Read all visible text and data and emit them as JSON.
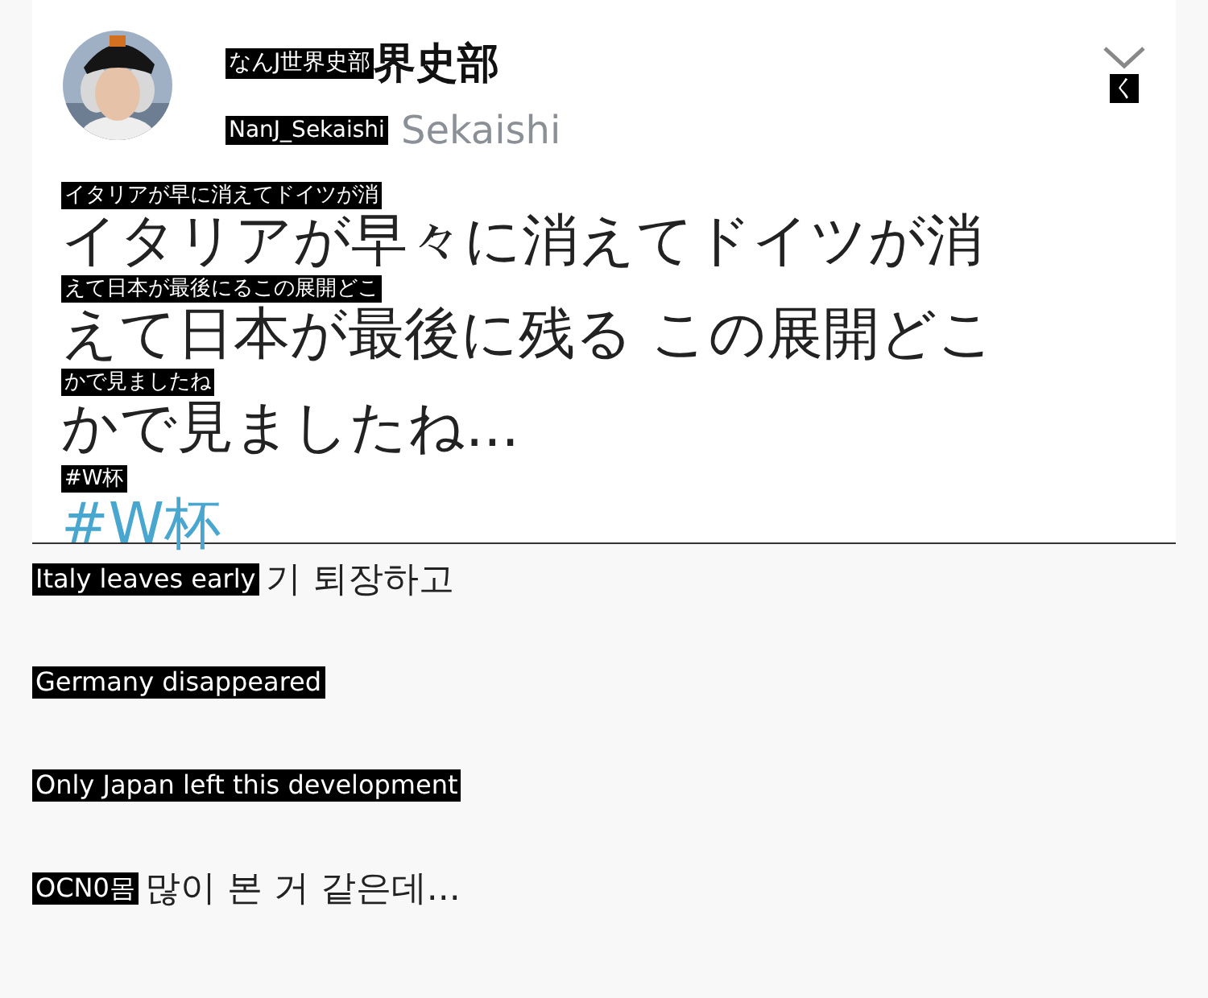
{
  "tweet": {
    "name": {
      "overlay": "なんJ世界史部",
      "text": "界史部"
    },
    "handle": {
      "overlay": "NanJ_Sekaishi",
      "text": "Sekaishi"
    },
    "menu": {
      "overlay": "く"
    },
    "lines": [
      {
        "overlay": "イタリアが早に消えてドイツが消",
        "text": "イタリアが早々に消えてドイツが消"
      },
      {
        "overlay": "えて日本が最後にるこの展開どこ",
        "text": "えて日本が最後に残る この展開どこ"
      },
      {
        "overlay": "かで見ましたね",
        "text": "かで見ましたね..."
      }
    ],
    "hashtag": {
      "overlay": "#W杯",
      "text": "#W杯"
    }
  },
  "comment_lines": [
    {
      "overlay": "Italy leaves early",
      "text": "기 퇴장하고"
    },
    {
      "overlay": "Germany disappeared"
    },
    {
      "overlay": "Only Japan left this development"
    },
    {
      "overlay": "OCN0몸",
      "text": "많이 본 거 같은데..."
    }
  ]
}
